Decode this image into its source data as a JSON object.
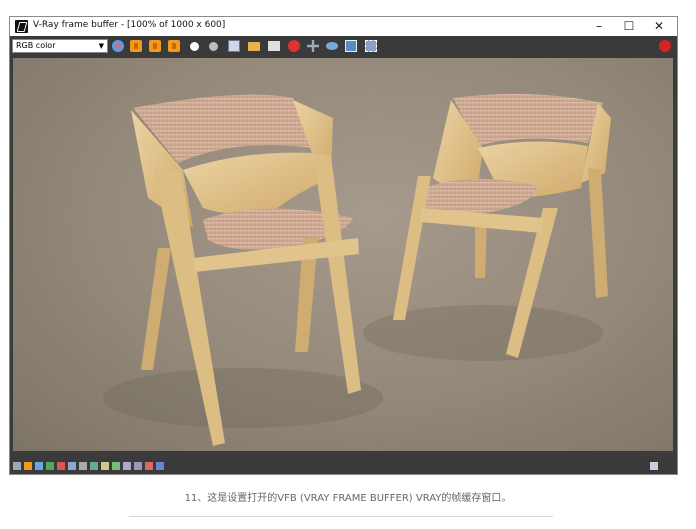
{
  "window": {
    "title": "V-Ray frame buffer - [100% of 1000 x 600]",
    "minimize_glyph": "–",
    "maximize_glyph": "☐",
    "close_glyph": "✕"
  },
  "toolbar": {
    "channel_value": "RGB color",
    "icons": [
      "color-wheel-icon",
      "red-channel-icon",
      "green-channel-icon",
      "blue-channel-icon",
      "alpha-white-icon",
      "monochrome-icon",
      "save-icon",
      "open-folder-icon",
      "clear-icon",
      "stop-render-icon",
      "track-mouse-icon",
      "lens-icon",
      "region-render-icon",
      "link-icon",
      "render-stamp-icon"
    ]
  },
  "statusbar": {
    "icons": [
      "histogram-icon",
      "lut-icon",
      "exposure-icon",
      "color-correct-icon",
      "levels-icon",
      "curves-icon",
      "bg-image-icon",
      "stamp-icon",
      "lens-fx-icon",
      "compare-icon",
      "ab-h-icon",
      "ab-v-icon",
      "history-icon",
      "pin-icon",
      "expand-icon"
    ]
  },
  "caption": "11、这是设置打开的VFB (VRAY FRAME BUFFER) VRAY的帧缓存窗口。",
  "colors": {
    "orange": "#f29a1e",
    "toolbar_bg": "#3a3a3a",
    "render_bg": "#938879",
    "wood": "#e3c58f",
    "cushion": "#d7b4a0"
  }
}
